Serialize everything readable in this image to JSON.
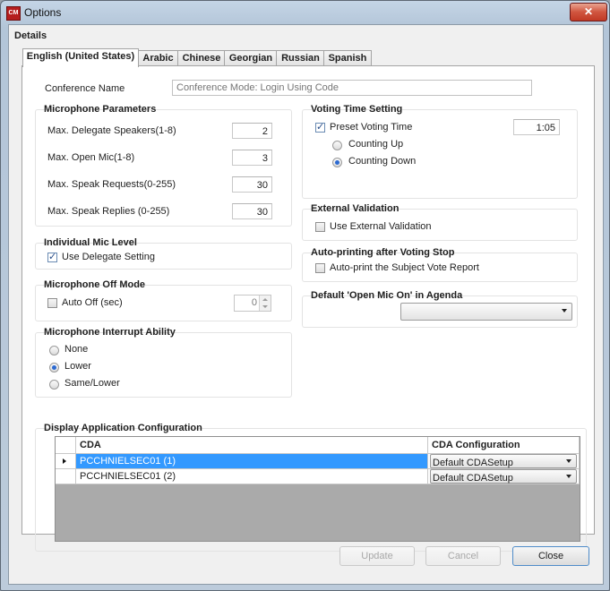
{
  "window": {
    "title": "Options",
    "app_icon_text": "CM"
  },
  "details_label": "Details",
  "tabs": [
    {
      "label": "English (United States)",
      "active": true
    },
    {
      "label": "Arabic"
    },
    {
      "label": "Chinese"
    },
    {
      "label": "Georgian"
    },
    {
      "label": "Russian"
    },
    {
      "label": "Spanish"
    }
  ],
  "conference": {
    "label": "Conference Name",
    "placeholder": "Conference Mode: Login Using Code"
  },
  "mic_params": {
    "title": "Microphone Parameters",
    "rows": [
      {
        "label": "Max. Delegate Speakers(1-8)",
        "value": "2"
      },
      {
        "label": "Max. Open Mic(1-8)",
        "value": "3"
      },
      {
        "label": "Max. Speak Requests(0-255)",
        "value": "30"
      },
      {
        "label": "Max. Speak Replies (0-255)",
        "value": "30"
      }
    ]
  },
  "voting": {
    "title": "Voting Time Setting",
    "preset_label": "Preset Voting Time",
    "preset_checked": true,
    "time_value": "1:05",
    "counting_up": "Counting Up",
    "counting_down": "Counting Down",
    "selected": "Counting Down"
  },
  "external": {
    "title": "External Validation",
    "checkbox_label": "Use External Validation",
    "checked": false
  },
  "autoprint": {
    "title": "Auto-printing after Voting Stop",
    "checkbox_label": "Auto-print the Subject Vote Report",
    "checked": false
  },
  "open_mic": {
    "title": "Default 'Open Mic On' in Agenda",
    "value": ""
  },
  "individual_mic": {
    "title": "Individual Mic Level",
    "checkbox_label": "Use Delegate Setting",
    "checked": true
  },
  "mic_off": {
    "title": "Microphone Off Mode",
    "checkbox_label": "Auto Off (sec)",
    "checked": false,
    "value": "0"
  },
  "interrupt": {
    "title": "Microphone Interrupt Ability",
    "options": [
      "None",
      "Lower",
      "Same/Lower"
    ],
    "selected": "Lower"
  },
  "display_config": {
    "title": "Display Application Configuration",
    "columns": [
      "CDA",
      "CDA Configuration"
    ],
    "rows": [
      {
        "cda": "PCCHNIELSEC01 (1)",
        "config": "Default CDASetup",
        "selected": true
      },
      {
        "cda": "PCCHNIELSEC01 (2)",
        "config": "Default CDASetup",
        "selected": false
      }
    ]
  },
  "buttons": {
    "update": "Update",
    "cancel": "Cancel",
    "close": "Close"
  },
  "colors": {
    "selection": "#3399ff",
    "window_frame": "#b9cadb",
    "close_button": "#c94b35"
  }
}
